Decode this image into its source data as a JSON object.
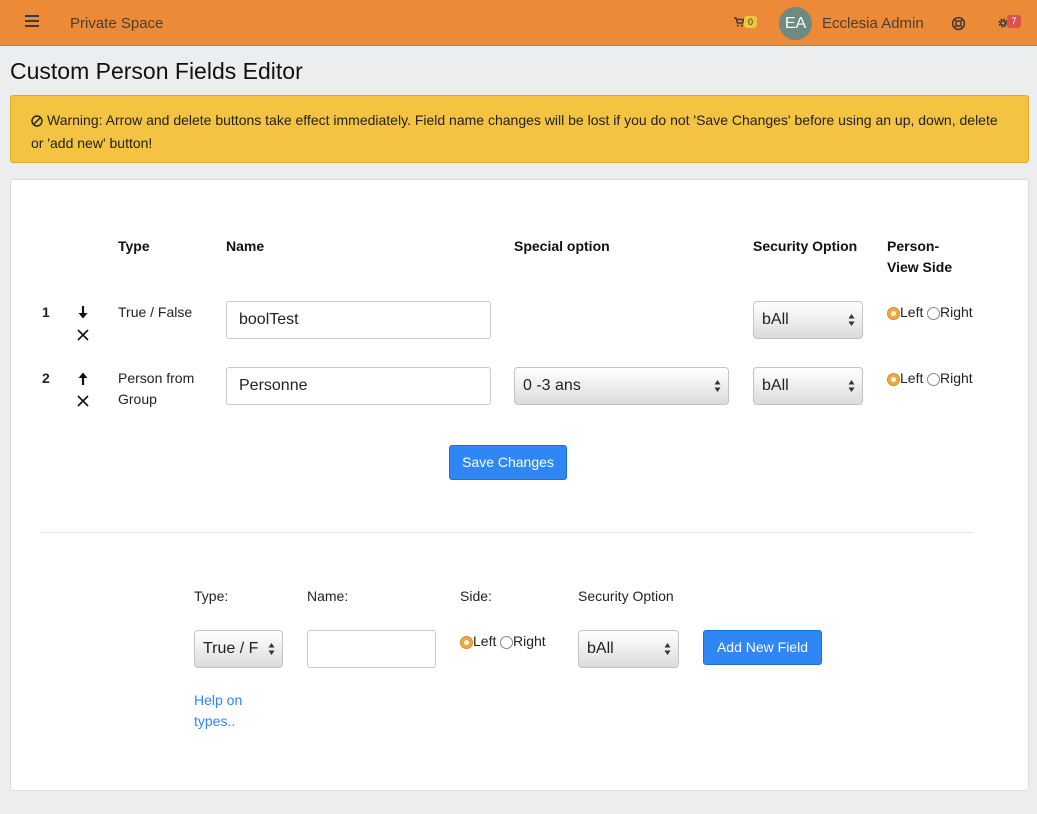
{
  "topbar": {
    "brand": "Private Space",
    "cart_count": "0",
    "avatar_initials": "EA",
    "user_name": "Ecclesia Admin",
    "settings_badge": "7"
  },
  "page": {
    "title": "Custom Person Fields Editor"
  },
  "warning": {
    "text": "Warning: Arrow and delete buttons take effect immediately. Field name changes will be lost if you do not 'Save Changes' before using an up, down, delete or 'add new' button!"
  },
  "table": {
    "headers": {
      "type": "Type",
      "name": "Name",
      "special": "Special option",
      "security": "Security Option",
      "side_line1": "Person-",
      "side_line2": "View Side"
    },
    "rows": [
      {
        "index": "1",
        "type": "True / False",
        "name": "boolTest",
        "special": "",
        "security": "bAll",
        "side_left": "Left",
        "side_right": "Right",
        "side_selected": "Left"
      },
      {
        "index": "2",
        "type_line1": "Person from",
        "type_line2": "Group",
        "name": "Personne",
        "special": "0 -3 ans",
        "security": "bAll",
        "side_left": "Left",
        "side_right": "Right",
        "side_selected": "Left"
      }
    ],
    "save_label": "Save Changes"
  },
  "new_field": {
    "type_label": "Type:",
    "name_label": "Name:",
    "side_label": "Side:",
    "security_label": "Security Option",
    "type_value": "True / False",
    "name_value": "",
    "side_left": "Left",
    "side_right": "Right",
    "security_value": "bAll",
    "add_label": "Add New Field",
    "help_line1": "Help on",
    "help_line2": "types.."
  },
  "colors": {
    "topbar": "#ec8a37",
    "warning": "#f3c341",
    "primary": "#2f86f5",
    "radio_selected": "#f0a840"
  }
}
